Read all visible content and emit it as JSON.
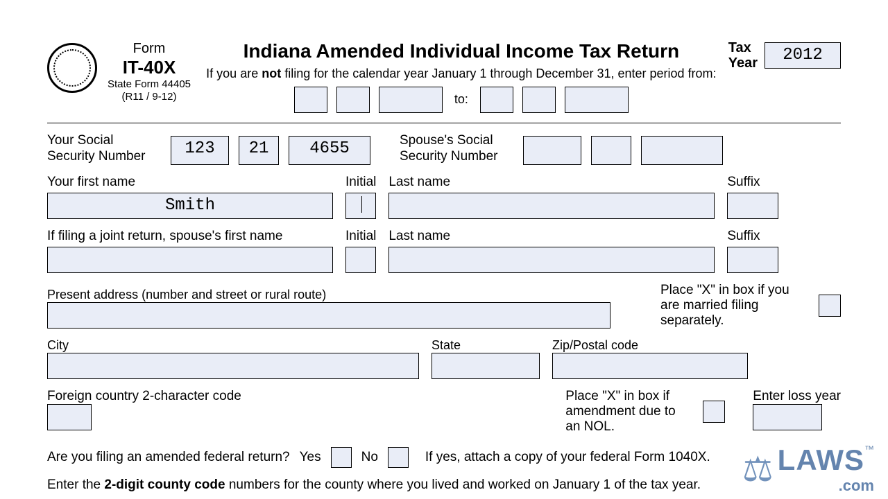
{
  "header": {
    "form_label": "Form",
    "form_code": "IT-40X",
    "state_form": "State Form 44405",
    "revision": "(R11 / 9-12)",
    "title": "Indiana Amended Individual Income Tax Return",
    "instruction_prefix": "If you are ",
    "instruction_not": "not",
    "instruction_suffix": " filing for the calendar year January 1 through December 31, enter period from:",
    "period_to": "to:",
    "tax_year_label": "Tax\nYear",
    "tax_year_value": "2012"
  },
  "ssn": {
    "your_label": "Your Social\nSecurity Number",
    "your_1": "123",
    "your_2": "21",
    "your_3": "4655",
    "spouse_label": "Spouse's Social\nSecurity Number",
    "spouse_1": "",
    "spouse_2": "",
    "spouse_3": ""
  },
  "name1": {
    "first_label": "Your first name",
    "first_value": "Smith",
    "initial_label": "Initial",
    "initial_value": "",
    "last_label": "Last name",
    "last_value": "",
    "suffix_label": "Suffix",
    "suffix_value": ""
  },
  "name2": {
    "first_label": "If filing a joint return, spouse's first name",
    "first_value": "",
    "initial_label": "Initial",
    "initial_value": "",
    "last_label": "Last name",
    "last_value": "",
    "suffix_label": "Suffix",
    "suffix_value": ""
  },
  "address": {
    "label": "Present address (number and street or rural route)",
    "value": "",
    "mfs_text": "Place \"X\" in box if you are married filing separately.",
    "mfs_value": ""
  },
  "csz": {
    "city_label": "City",
    "city_value": "",
    "state_label": "State",
    "state_value": "",
    "zip_label": "Zip/Postal code",
    "zip_value": ""
  },
  "foreign": {
    "fc_label": "Foreign country 2-character code",
    "fc_value": "",
    "nol_text": "Place \"X\" in box if amendment due to an NOL.",
    "nol_value": "",
    "loss_label": "Enter loss year",
    "loss_value": ""
  },
  "amended": {
    "question": "Are you filing an amended federal return?",
    "yes": "Yes",
    "no": "No",
    "note": "If yes, attach a copy of your federal Form 1040X."
  },
  "county": {
    "prefix": "Enter the ",
    "bold": "2-digit county code",
    "suffix": " numbers for the county where you lived and worked on January 1 of the tax year."
  },
  "watermark": {
    "text": "LAWS",
    "tm": "™",
    "domain": ".com"
  }
}
